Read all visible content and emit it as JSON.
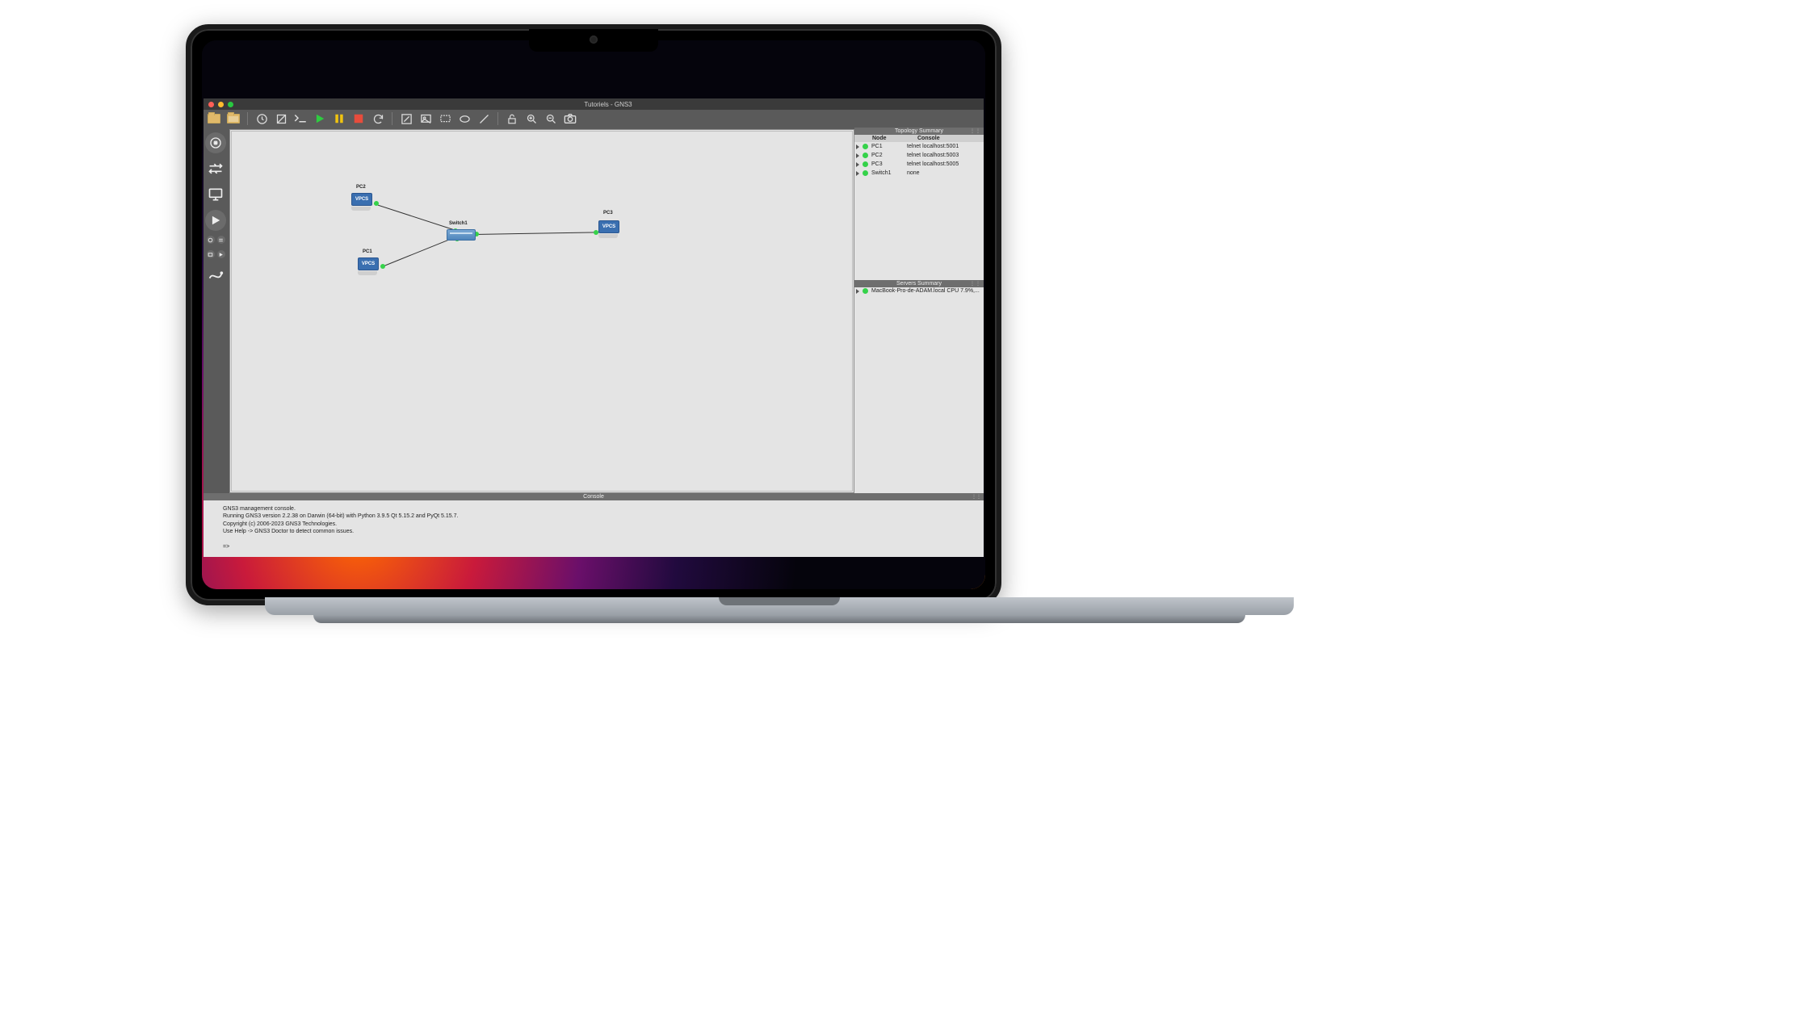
{
  "window": {
    "title": "Tutoriels - GNS3"
  },
  "toolbar": {
    "new_project": "new-project",
    "open_project": "open-project",
    "recent": "recent",
    "snapshot": "snapshot",
    "console": "console",
    "start": "start",
    "pause": "pause",
    "stop": "stop",
    "reload": "reload",
    "note": "note",
    "image": "image",
    "rect": "rect",
    "ellipse": "ellipse",
    "line": "line",
    "lock": "lock",
    "zoom_in": "zoom-in",
    "zoom_out": "zoom-out",
    "screenshot": "screenshot"
  },
  "dock": {
    "routers": "routers",
    "switches": "switches",
    "end_devices": "end-devices",
    "security": "security",
    "all": "all-devices",
    "link": "add-link"
  },
  "canvas": {
    "nodes": {
      "pc1": {
        "label": "PC1",
        "device": "VPCS"
      },
      "pc2": {
        "label": "PC2",
        "device": "VPCS"
      },
      "pc3": {
        "label": "PC3",
        "device": "VPCS"
      },
      "sw1": {
        "label": "Switch1"
      }
    }
  },
  "topology": {
    "title": "Topology Summary",
    "headers": {
      "node": "Node",
      "console": "Console"
    },
    "rows": [
      {
        "name": "PC1",
        "console": "telnet localhost:5001"
      },
      {
        "name": "PC2",
        "console": "telnet localhost:5003"
      },
      {
        "name": "PC3",
        "console": "telnet localhost:5005"
      },
      {
        "name": "Switch1",
        "console": "none"
      }
    ]
  },
  "servers": {
    "title": "Servers Summary",
    "row": "MacBook-Pro-de-ADAM.local CPU 7.9%,..."
  },
  "console_panel": {
    "title": "Console",
    "lines": "GNS3 management console.\nRunning GNS3 version 2.2.38 on Darwin (64-bit) with Python 3.9.5 Qt 5.15.2 and PyQt 5.15.7.\nCopyright (c) 2006-2023 GNS3 Technologies.\nUse Help -> GNS3 Doctor to detect common issues.\n\n=>"
  }
}
